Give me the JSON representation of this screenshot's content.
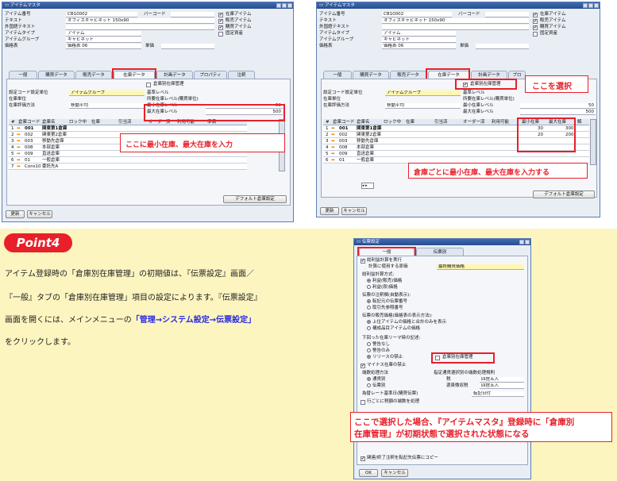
{
  "left": {
    "title": "アイテムマスタ",
    "fields": {
      "item_no_label": "アイテム番号",
      "item_no": "CB10002",
      "text_label": "テキスト",
      "text": "オフィスキャビネット 150x90",
      "foreign_label": "外国語テキスト",
      "type_label": "アイテムタイプ",
      "type": "アイテム",
      "group_label": "アイテムグループ",
      "group": "キャビネット",
      "price_label": "価格表",
      "price": "価格表 06",
      "barcode_label": "バーコード",
      "unit_label": "単価"
    },
    "checks": {
      "inventory": "在庫アイテム",
      "sales": "販売アイテム",
      "purchase": "購買アイテム",
      "fixed": "固定資産"
    },
    "tabs": [
      "一般",
      "購買データ",
      "販売データ",
      "在庫データ",
      "計画データ",
      "プロパティ",
      "注釈"
    ],
    "wh_check": "倉庫別在庫管理",
    "inv": {
      "setting_label": "設定コード設定単位",
      "setting": "アイテムグループ",
      "unit_label": "在庫単位",
      "method_label": "在庫評価方法",
      "method": "移動平均",
      "req_label": "基準レベル",
      "pur_label": "所要在庫レベル(購買単位)",
      "min_label": "最小在庫レベル",
      "min": "50",
      "max_label": "最大在庫レベル",
      "max": "500"
    },
    "grid_headers": [
      "#",
      "倉庫コード",
      "倉庫名",
      "ロック中",
      "在庫",
      "引当済",
      "オーダー済",
      "利用可能",
      "準備"
    ],
    "rows": [
      [
        "1",
        "001",
        "関東第1倉庫"
      ],
      [
        "2",
        "002",
        "関東第2倉庫"
      ],
      [
        "3",
        "003",
        "移動先倉庫"
      ],
      [
        "4",
        "008",
        "本部倉庫"
      ],
      [
        "5",
        "009",
        "直送倉庫"
      ],
      [
        "6",
        "01",
        "一般倉庫"
      ],
      [
        "7",
        "Cons10",
        "委託先A"
      ]
    ],
    "callout": "ここに最小在庫、最大在庫を入力",
    "default_btn": "デフォルト倉庫設定",
    "update_btn": "更新",
    "cancel_btn": "キャンセル"
  },
  "right": {
    "title": "アイテムマスタ",
    "fields": {
      "item_no_label": "アイテム番号",
      "item_no": "CB10002",
      "text_label": "テキスト",
      "text": "オフィスキャビネット 150x90",
      "foreign_label": "外国語テキスト",
      "type_label": "アイテムタイプ",
      "type": "アイテム",
      "group_label": "アイテムグループ",
      "group": "キャビネット",
      "price_label": "価格表",
      "price": "価格表 06",
      "barcode_label": "バーコード",
      "unit_label": "単価"
    },
    "checks": {
      "inventory": "在庫アイテム",
      "sales": "販売アイテム",
      "purchase": "購買アイテム",
      "fixed": "固定資産"
    },
    "tabs": [
      "一般",
      "購買データ",
      "販売データ",
      "在庫データ",
      "計画データ",
      "プロ"
    ],
    "wh_check": "倉庫別在庫管理",
    "select_callout": "ここを選択",
    "inv": {
      "setting_label": "設定コード設定単位",
      "setting": "アイテムグループ",
      "unit_label": "在庫単位",
      "method_label": "在庫評価方法",
      "method": "移動平均",
      "req_label": "基準レベル",
      "pur_label": "所要在庫レベル(購買単位)",
      "min_label": "最小在庫レベル",
      "min": "50",
      "max_label": "最大在庫レベル",
      "max": "500"
    },
    "grid_headers": [
      "#",
      "倉庫コード",
      "倉庫名",
      "ロック中",
      "在庫",
      "引当済",
      "オーダー済",
      "利用可能",
      "最小在庫",
      "最大在庫",
      "解"
    ],
    "rows": [
      [
        "1",
        "001",
        "関東第1倉庫",
        "30",
        "300"
      ],
      [
        "2",
        "002",
        "関東第2倉庫",
        "20",
        "200"
      ],
      [
        "3",
        "003",
        "移動先倉庫",
        "",
        ""
      ],
      [
        "4",
        "008",
        "本部倉庫",
        "",
        ""
      ],
      [
        "5",
        "009",
        "直送倉庫",
        "",
        ""
      ],
      [
        "6",
        "01",
        "一般倉庫",
        "",
        ""
      ]
    ],
    "callout": "倉庫ごとに最小在庫、最大在庫を入力する",
    "default_btn": "デフォルト倉庫設定",
    "update_btn": "更新",
    "cancel_btn": "キャンセル"
  },
  "point": {
    "badge": "Point4",
    "line1": "アイテム登録時の「倉庫別在庫管理」の初期値は、『伝票設定』画面／",
    "line2": "『一般』タブの「倉庫別在庫管理」項目の設定によります。『伝票設定』",
    "line3a": "画面を開くには、メインメニューの",
    "line3b": "「管理→システム設定→伝票設定」",
    "line4": "をクリックします。"
  },
  "settings": {
    "title": "伝票設定",
    "tabs": [
      "一般",
      "伝票別"
    ],
    "cb_total": "総利益計算を実行",
    "base_label": "計算に使用する原価",
    "base": "最終購買価格",
    "price_group": "総利益計算方式:",
    "price_opts": [
      "利益(販売)価格",
      "利益(原)価格"
    ],
    "pick_group": "伝票の注釈欄(自動表示):",
    "pick_opts": [
      "転記元の伝票番号",
      "取引先参照番号"
    ],
    "disp_group": "伝票の販売価格(価格表の表示方法):",
    "disp_opts": [
      "上位アイテムの価格と合計のみを表示",
      "構成品目アイテムの価格"
    ],
    "alert_group": "下回った在庫リーマ時の記述:",
    "alert_opts": [
      "警告なし",
      "警告のみ",
      "リリースの禁止"
    ],
    "wh_mgmt": "倉庫別在庫管理",
    "cb_neg": "マイナス在庫の禁止",
    "round_group": "端数処理方法",
    "round_opts": [
      "通貨別",
      "伝票別"
    ],
    "round_rule": "指定通貨選択別の端数処理規則",
    "tax_label": "税",
    "tax": "四捨五入",
    "src_label": "源泉徴収税",
    "src": "四捨五入",
    "rate_label": "為替レート基準日(購買伝票)",
    "rate": "転記日付",
    "cb_line": "行ごとに税額の端数を処理",
    "callout1": "ここで選択した場合、『アイテムマスタ』登録時に「倉庫別",
    "callout2": "在庫管理」が初期状態で選択された状態になる",
    "cb_copy": "関連/終了注釈を転記先伝票にコピー",
    "ok": "OK",
    "cancel": "キャンセル"
  },
  "colors": {
    "accent_red": "#e8202a",
    "point_bg": "#fdf5c0"
  }
}
